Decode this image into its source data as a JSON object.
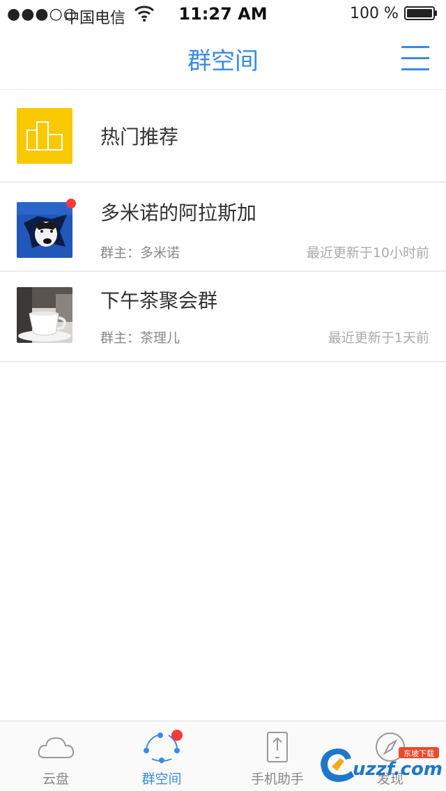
{
  "status_bar": {
    "signal": "●●●○○",
    "carrier": "中国电信",
    "time": "11:27 AM",
    "battery": "100 %"
  },
  "nav": {
    "title": "群空间"
  },
  "hot": {
    "label": "热门推荐"
  },
  "groups": [
    {
      "name": "多米诺的阿拉斯加",
      "owner": "群主：多米诺",
      "updated": "最近更新于10小时前",
      "unread": true
    },
    {
      "name": "下午茶聚会群",
      "owner": "群主：茶理儿",
      "updated": "最近更新于1天前",
      "unread": false
    }
  ],
  "tabs": [
    {
      "label": "云盘",
      "icon": "cloud-icon",
      "active": false
    },
    {
      "label": "群空间",
      "icon": "group-share-icon",
      "active": true,
      "badge": true
    },
    {
      "label": "手机助手",
      "icon": "phone-upload-icon",
      "active": false
    },
    {
      "label": "发现",
      "icon": "compass-icon",
      "active": false
    }
  ],
  "watermark": {
    "text": "uzzf.com",
    "tag": "东坡下载"
  },
  "colors": {
    "accent": "#3a8be0",
    "hot_icon_bg": "#f8c800",
    "badge": "#f23b3b"
  }
}
